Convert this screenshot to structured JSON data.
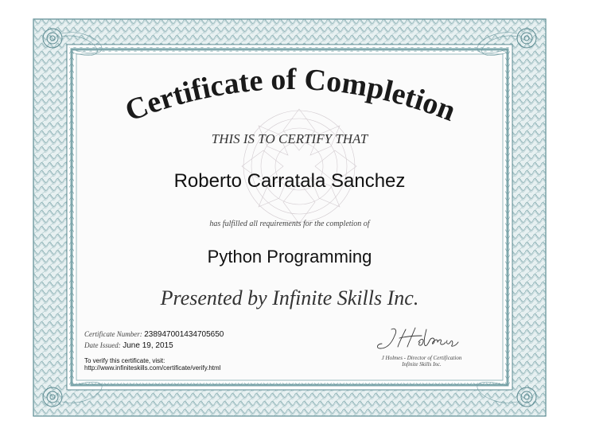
{
  "certificate": {
    "heading": "Certificate of Completion",
    "certify_line": "THIS IS TO CERTIFY THAT",
    "recipient": "Roberto Carratala Sanchez",
    "fulfilled_line": "has fulfilled all requirements for the completion of",
    "course": "Python Programming",
    "presented_by": "Presented by Infinite Skills Inc.",
    "certificate_number_label": "Certificate Number:",
    "certificate_number": "238947001434705650",
    "date_issued_label": "Date Issued:",
    "date_issued": "June 19, 2015",
    "verify_line1": "To verify this certificate, visit:",
    "verify_line2": "http://www.infiniteskills.com/certificate/verify.html",
    "signature": "J Holmes",
    "signer_title": "J Holmes - Director of Certification",
    "signer_company": "Infinite Skills Inc."
  },
  "colors": {
    "border": "#7fa8ad",
    "border_dark": "#5b8a91",
    "rosette": "#c9c0c6"
  }
}
